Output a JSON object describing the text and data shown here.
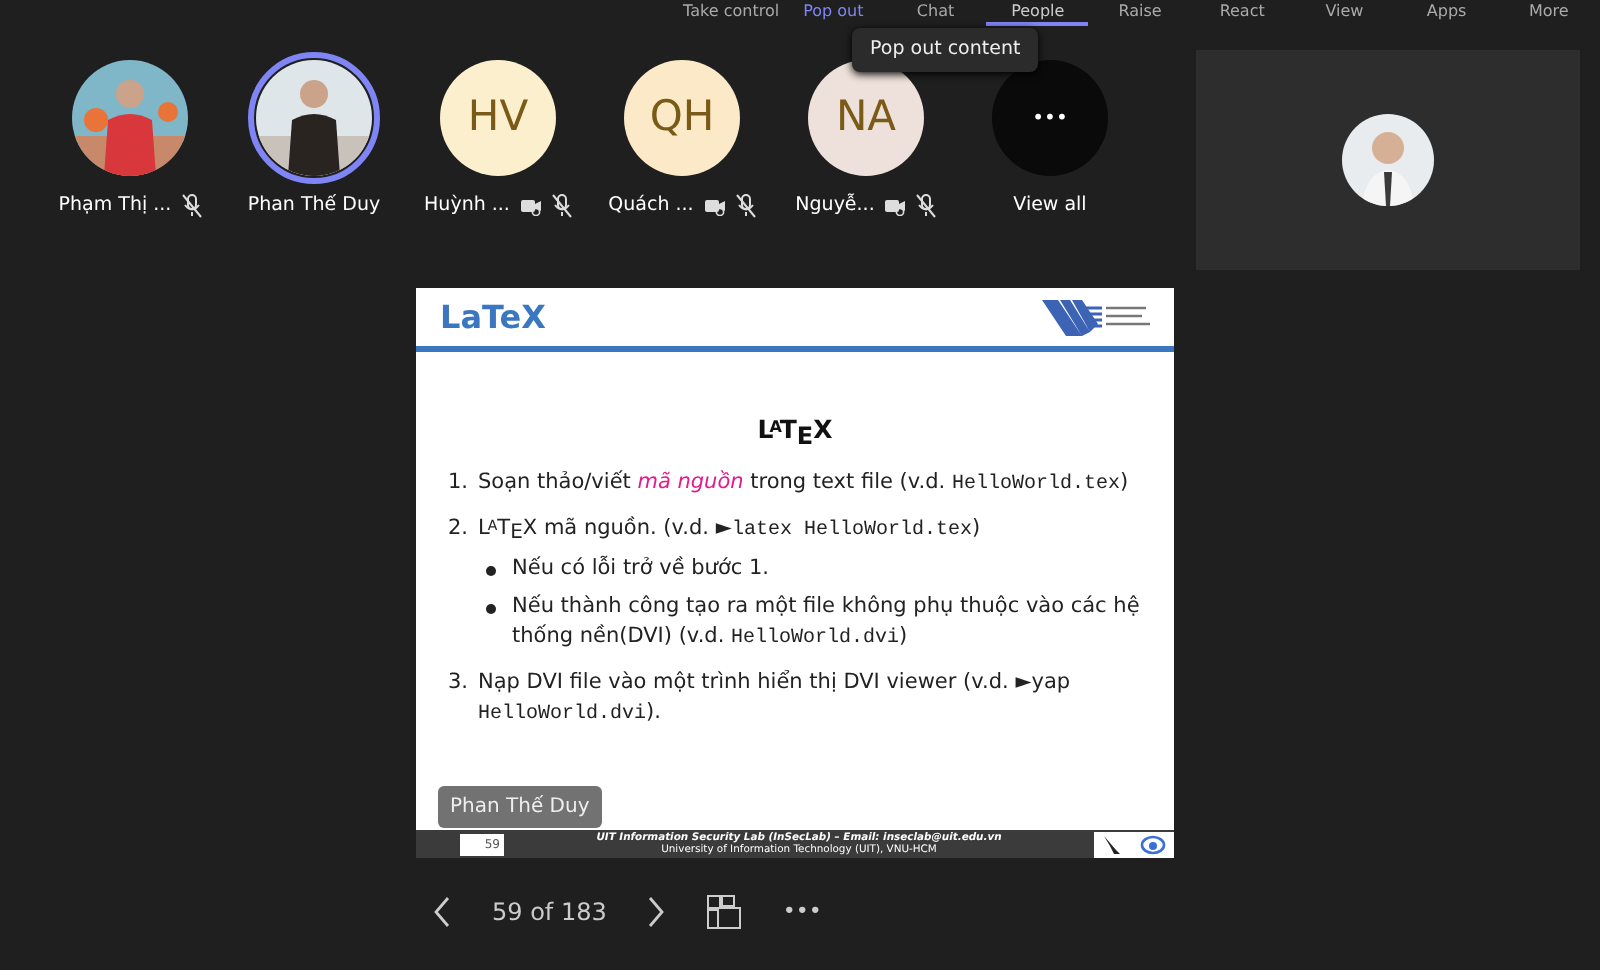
{
  "toolbar": [
    {
      "label": "Take control",
      "selected": false,
      "kind": "plain"
    },
    {
      "label": "Pop out",
      "selected": false,
      "kind": "link"
    },
    {
      "label": "Chat",
      "selected": false,
      "kind": "plain"
    },
    {
      "label": "People",
      "selected": true,
      "kind": "plain"
    },
    {
      "label": "Raise",
      "selected": false,
      "kind": "plain"
    },
    {
      "label": "React",
      "selected": false,
      "kind": "plain"
    },
    {
      "label": "View",
      "selected": false,
      "kind": "plain"
    },
    {
      "label": "Apps",
      "selected": false,
      "kind": "plain"
    },
    {
      "label": "More",
      "selected": false,
      "kind": "plain"
    }
  ],
  "tooltip": "Pop out content",
  "participants": [
    {
      "name": "Phạm Thị ...",
      "mic_off": true
    },
    {
      "name": "Phan Thế Duy",
      "speaking": true
    },
    {
      "name": "Huỳnh ...",
      "kind": "initials",
      "initials": "HV",
      "color": "#fbefcd",
      "camera_off": true,
      "mic_off": true
    },
    {
      "name": "Quách ...",
      "kind": "initials",
      "initials": "QH",
      "color": "#fbe9c8",
      "camera_off": true,
      "mic_off": true
    },
    {
      "name": "Nguyễ...",
      "kind": "initials",
      "initials": "NA",
      "color": "#eee0da",
      "camera_off": true,
      "mic_off": true
    },
    {
      "name": "View all",
      "kind": "more",
      "icon": "•••"
    }
  ],
  "slide": {
    "header": "LaTeX",
    "title": "L$^{A}$T$_{E}$X",
    "items": [
      {
        "number": "1.",
        "runs": [
          {
            "kind": "plain",
            "t": "Soạn thảo/viết "
          },
          {
            "kind": "em",
            "t": "mã nguồn"
          },
          {
            "kind": "plain",
            "t": " trong text file (v.d. "
          },
          {
            "kind": "code",
            "t": "HelloWorld.tex"
          },
          {
            "kind": "plain",
            "t": ")"
          }
        ]
      },
      {
        "number": "2.",
        "runs": [
          {
            "kind": "logo",
            "t": "L$^{A}$T$_{E}$X"
          },
          {
            "kind": "plain",
            "t": " mã nguồn. (v.d. ►"
          },
          {
            "kind": "code",
            "t": "latex HelloWorld.tex"
          },
          {
            "kind": "plain",
            "t": ")"
          }
        ],
        "bullets": [
          [
            {
              "kind": "plain",
              "t": "Nếu có lỗi trở về bước 1."
            }
          ],
          [
            {
              "kind": "plain",
              "t": "Nếu thành công tạo ra một file không phụ thuộc vào các hệ thống nền(DVI) (v.d. "
            },
            {
              "kind": "code",
              "t": "HelloWorld.dvi"
            },
            {
              "kind": "plain",
              "t": ")"
            }
          ]
        ]
      },
      {
        "number": "3.",
        "runs": [
          {
            "kind": "plain",
            "t": "Nạp DVI file vào một trình hiển thị DVI viewer (v.d. ►yap "
          },
          {
            "kind": "code",
            "t": "HelloWorld.dvi"
          },
          {
            "kind": "plain",
            "t": ")."
          }
        ]
      }
    ],
    "presenter": "Phan Thế Duy",
    "footer_page": "59",
    "footer_line_1": "UIT Information Security Lab (InSecLab) – Email: inseclab@uit.edu.vn",
    "footer_line_2": "University of Information Technology (UIT), VNU-HCM"
  },
  "pager": {
    "text": "59 of 183",
    "more": "•••"
  }
}
